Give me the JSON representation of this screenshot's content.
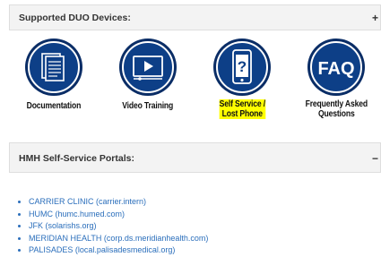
{
  "devices_panel": {
    "title": "Supported DUO Devices:",
    "toggle": "+"
  },
  "tiles": [
    {
      "label": "Documentation",
      "icon": "documents-icon",
      "highlighted": false
    },
    {
      "label": "Video Training",
      "icon": "video-player-icon",
      "highlighted": false
    },
    {
      "label_line1": "Self Service /",
      "label_line2": "Lost Phone",
      "icon": "phone-question-icon",
      "highlighted": true
    },
    {
      "label_line1": "Frequently Asked",
      "label_line2": "Questions",
      "icon": "faq-icon",
      "icon_text": "FAQ",
      "highlighted": false
    }
  ],
  "portals_panel": {
    "title": "HMH Self-Service Portals:",
    "toggle": "−"
  },
  "portals": [
    "CARRIER CLINIC (carrier.intern)",
    "HUMC (humc.humed.com)",
    "JFK (solarishs.org)",
    "MERIDIAN HEALTH (corp.ds.meridianhealth.com)",
    "PALISADES (local.palisadesmedical.org)"
  ],
  "colors": {
    "icon_fill": "#0d3f87",
    "icon_ring": "#0a2d66",
    "link": "#2a6ebb",
    "highlight": "#ffff00"
  }
}
